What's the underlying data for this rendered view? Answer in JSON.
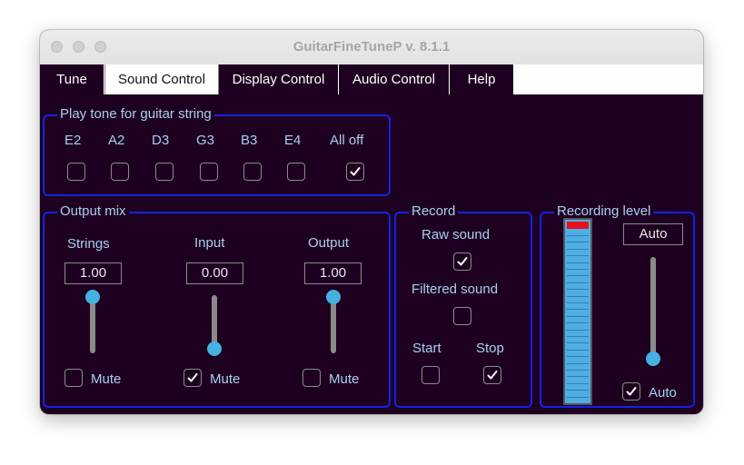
{
  "window": {
    "title": "GuitarFineTuneP v. 8.1.1"
  },
  "tabs": [
    {
      "label": "Tune",
      "active": false
    },
    {
      "label": "Sound Control",
      "active": true
    },
    {
      "label": "Display Control",
      "active": false
    },
    {
      "label": "Audio Control",
      "active": false
    },
    {
      "label": "Help",
      "active": false
    }
  ],
  "play_tone": {
    "title": "Play tone for guitar string",
    "strings": [
      {
        "label": "E2",
        "checked": false
      },
      {
        "label": "A2",
        "checked": false
      },
      {
        "label": "D3",
        "checked": false
      },
      {
        "label": "G3",
        "checked": false
      },
      {
        "label": "B3",
        "checked": false
      },
      {
        "label": "E4",
        "checked": false
      },
      {
        "label": "All off",
        "checked": true
      }
    ]
  },
  "output_mix": {
    "title": "Output mix",
    "channels": [
      {
        "label": "Strings",
        "value": "1.00",
        "level": 1.0,
        "mute_label": "Mute",
        "muted": false
      },
      {
        "label": "Input",
        "value": "0.00",
        "level": 0.0,
        "mute_label": "Mute",
        "muted": true
      },
      {
        "label": "Output",
        "value": "1.00",
        "level": 1.0,
        "mute_label": "Mute",
        "muted": false
      }
    ]
  },
  "record": {
    "title": "Record",
    "raw_label": "Raw sound",
    "raw_checked": true,
    "filtered_label": "Filtered sound",
    "filtered_checked": false,
    "start_label": "Start",
    "start_checked": false,
    "stop_label": "Stop",
    "stop_checked": true
  },
  "recording_level": {
    "title": "Recording level",
    "value": "Auto",
    "auto_label": "Auto",
    "auto_checked": true,
    "slider_level": 0.0,
    "meter_peak_fraction": 1.0
  },
  "colors": {
    "panel_border": "#1522e6",
    "label_text": "#a9cff2",
    "background": "#1e0120",
    "slider_knob": "#46b0e0",
    "meter_fill": "#50aee4",
    "meter_peak": "#e8101a"
  }
}
